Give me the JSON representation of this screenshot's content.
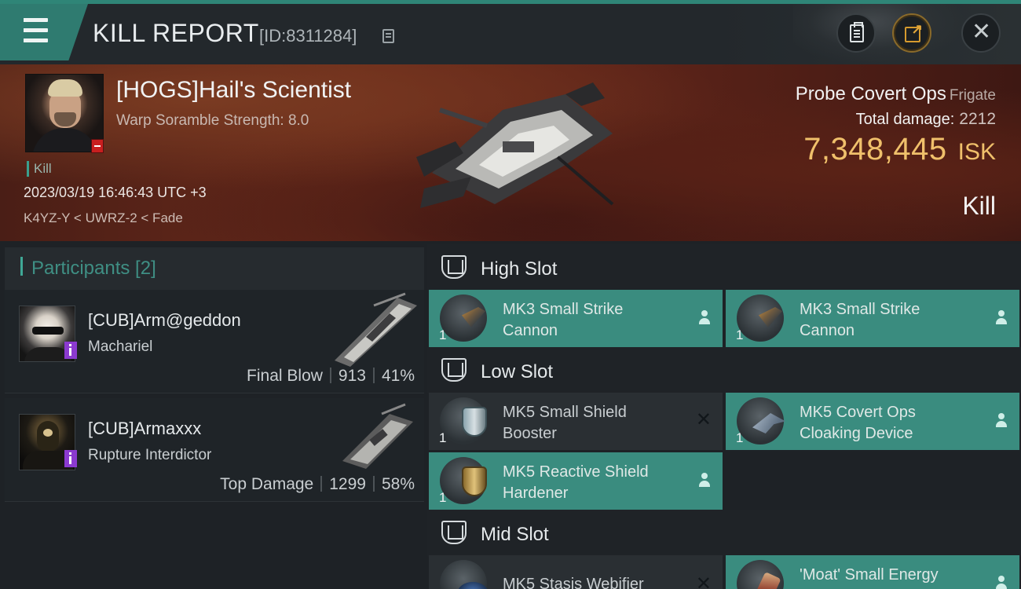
{
  "header": {
    "title": "KILL REPORT",
    "report_id": "[ID:8311284]",
    "icons": {
      "menu": "menu-icon",
      "copy": "copy-icon",
      "clipboard": "clipboard-icon",
      "share": "share-icon",
      "close": "close-icon"
    }
  },
  "victim": {
    "name": "[HOGS]Hail's Scientist",
    "scramble": "Warp Soramble Strength: 8.0",
    "kill_tag": "Kill",
    "datetime": "2023/03/19 16:46:43 UTC +3",
    "location": "K4YZ-Y < UWRZ-2 < Fade",
    "ship_name": "Probe Covert Ops",
    "ship_class": "Frigate",
    "total_damage_label": "Total damage:",
    "total_damage": "2212",
    "isk_value": "7,348,445",
    "isk_unit": "ISK",
    "result": "Kill"
  },
  "participants": {
    "label": "Participants [2]",
    "rows": [
      {
        "name": "[CUB]Arm@geddon",
        "ship": "Machariel",
        "role": "Final Blow",
        "damage": "913",
        "percent": "41%"
      },
      {
        "name": "[CUB]Armaxxx",
        "ship": "Rupture Interdictor",
        "role": "Top Damage",
        "damage": "1299",
        "percent": "58%"
      }
    ]
  },
  "slots": {
    "high": {
      "label": "High Slot",
      "modules": [
        {
          "qty": "1",
          "name_l1": "MK3 Small Strike",
          "name_l2": "Cannon"
        },
        {
          "qty": "1",
          "name_l1": "MK3 Small Strike",
          "name_l2": "Cannon"
        }
      ]
    },
    "low": {
      "label": "Low Slot",
      "modules": [
        {
          "qty": "1",
          "name_l1": "MK5 Small Shield",
          "name_l2": "Booster"
        },
        {
          "qty": "1",
          "name_l1": "MK5 Covert Ops",
          "name_l2": "Cloaking Device"
        },
        {
          "qty": "1",
          "name_l1": "MK5 Reactive Shield",
          "name_l2": "Hardener"
        }
      ]
    },
    "mid": {
      "label": "Mid Slot",
      "modules": [
        {
          "qty": "",
          "name_l1": "MK5 Stasis Webifier",
          "name_l2": ""
        },
        {
          "qty": "",
          "name_l1": "'Moat' Small Energy",
          "name_l2": ""
        }
      ]
    }
  },
  "colors": {
    "accent": "#3a8c7f",
    "isk": "#f0c06b",
    "destroyed_badge": "#c81f1f",
    "attacker_badge": "#8b3ad0"
  }
}
